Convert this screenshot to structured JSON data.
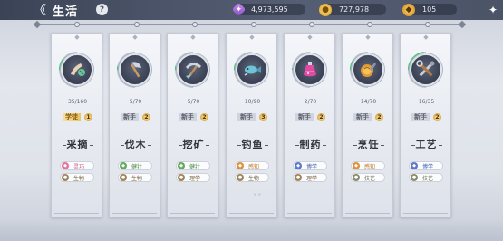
{
  "header": {
    "title": "生活",
    "help_label": "?",
    "back_label": "《",
    "close_label": "✦"
  },
  "currencies": [
    {
      "icon": "crystal-icon",
      "value": "4,973,595",
      "color": "#a86ad8"
    },
    {
      "icon": "gold-coin-icon",
      "value": "727,978",
      "color": "#e0a52a"
    },
    {
      "icon": "token-icon",
      "value": "105",
      "color": "#d5962a"
    }
  ],
  "skills": [
    {
      "name": "采摘",
      "progress": "35/160",
      "rank": "学徒",
      "level": "1",
      "rank_highlight": true,
      "icon": "gathering-hand-icon",
      "fill": 0.22,
      "attrs": [
        {
          "label": "灵巧",
          "color": "pink",
          "glyph": "◆"
        },
        {
          "label": "生物",
          "color": "brown",
          "glyph": "●"
        }
      ]
    },
    {
      "name": "伐木",
      "progress": "5/70",
      "rank": "新手",
      "level": "2",
      "rank_highlight": false,
      "icon": "axe-icon",
      "fill": 0.07,
      "attrs": [
        {
          "label": "健壮",
          "color": "green",
          "glyph": "◆"
        },
        {
          "label": "生物",
          "color": "brown",
          "glyph": "●"
        }
      ]
    },
    {
      "name": "挖矿",
      "progress": "5/70",
      "rank": "新手",
      "level": "2",
      "rank_highlight": false,
      "icon": "pickaxe-icon",
      "fill": 0.07,
      "attrs": [
        {
          "label": "健壮",
          "color": "green",
          "glyph": "◆"
        },
        {
          "label": "理学",
          "color": "brown",
          "glyph": "●"
        }
      ]
    },
    {
      "name": "钓鱼",
      "progress": "10/90",
      "rank": "新手",
      "level": "3",
      "rank_highlight": false,
      "icon": "fish-icon",
      "fill": 0.11,
      "attrs": [
        {
          "label": "感知",
          "color": "orange",
          "glyph": "◆"
        },
        {
          "label": "生物",
          "color": "brown",
          "glyph": "●"
        }
      ]
    },
    {
      "name": "制药",
      "progress": "2/70",
      "rank": "新手",
      "level": "2",
      "rank_highlight": false,
      "icon": "potion-icon",
      "fill": 0.03,
      "attrs": [
        {
          "label": "博学",
          "color": "blue",
          "glyph": "◆"
        },
        {
          "label": "理学",
          "color": "brown",
          "glyph": "●"
        }
      ]
    },
    {
      "name": "烹饪",
      "progress": "14/70",
      "rank": "新手",
      "level": "2",
      "rank_highlight": false,
      "icon": "cooking-pan-icon",
      "fill": 0.2,
      "attrs": [
        {
          "label": "感知",
          "color": "orange",
          "glyph": "◆"
        },
        {
          "label": "技艺",
          "color": "teal",
          "glyph": "●"
        }
      ]
    },
    {
      "name": "工艺",
      "progress": "16/35",
      "rank": "新手",
      "level": "2",
      "rank_highlight": false,
      "icon": "crafting-tools-icon",
      "fill": 0.46,
      "attrs": [
        {
          "label": "博学",
          "color": "blue",
          "glyph": "◆"
        },
        {
          "label": "技艺",
          "color": "teal",
          "glyph": "●"
        }
      ]
    }
  ]
}
